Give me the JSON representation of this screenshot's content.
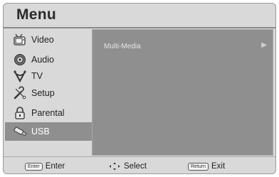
{
  "header": {
    "title": "Menu"
  },
  "sidebar": {
    "items": [
      {
        "label": "Video",
        "icon": "tv-video-icon",
        "active": false
      },
      {
        "label": "Audio",
        "icon": "speaker-audio-icon",
        "active": false
      },
      {
        "label": "TV",
        "icon": "antenna-tv-icon",
        "active": false
      },
      {
        "label": "Setup",
        "icon": "tools-setup-icon",
        "active": false
      },
      {
        "label": "Parental",
        "icon": "padlock-icon",
        "active": false
      },
      {
        "label": "USB",
        "icon": "usb-stick-icon",
        "active": true
      }
    ]
  },
  "content": {
    "rows": [
      {
        "label": "Multi-Media",
        "arrow": "▶"
      }
    ]
  },
  "footer": {
    "enter": {
      "key": "Enter",
      "label": "Enter"
    },
    "select": {
      "label": "Select"
    },
    "exit": {
      "key": "Return",
      "label": "Exit"
    }
  },
  "colors": {
    "frame": "#d9d9d9",
    "panel": "#8f8f8f",
    "active_item": "#8f8f8f"
  }
}
